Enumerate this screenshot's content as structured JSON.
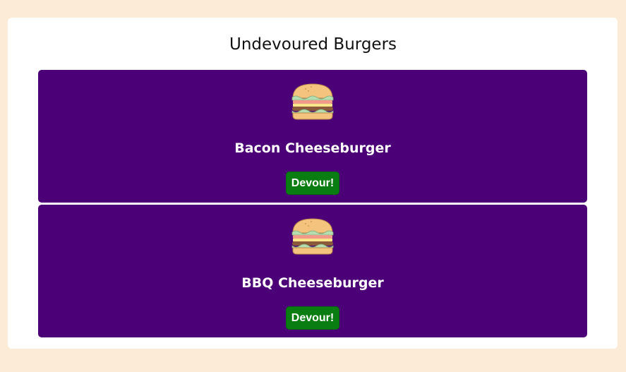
{
  "page": {
    "title": "Undevoured Burgers"
  },
  "burgers": [
    {
      "name": "Bacon Cheeseburger",
      "icon": "burger-icon",
      "button_label": "Devour!"
    },
    {
      "name": "BBQ Cheeseburger",
      "icon": "burger-icon",
      "button_label": "Devour!"
    }
  ],
  "colors": {
    "page_bg": "#fbebd7",
    "panel_bg": "#ffffff",
    "card_bg": "#4b0077",
    "button_bg": "#0a7d12"
  }
}
